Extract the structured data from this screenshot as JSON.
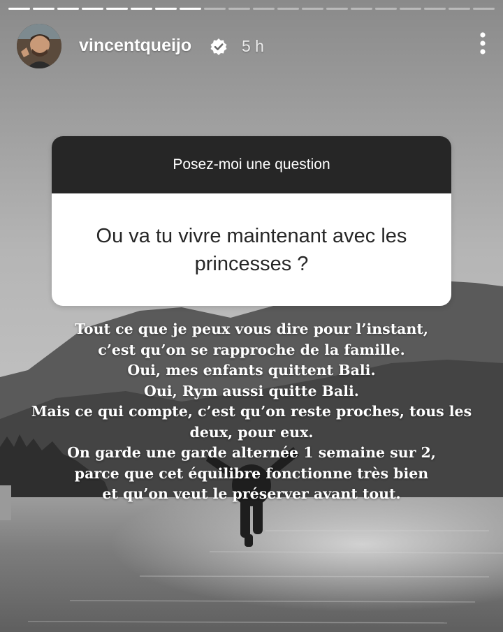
{
  "progress": {
    "total_segments": 20,
    "completed_segments": 8
  },
  "header": {
    "username": "vincentqueijo",
    "verified": true,
    "time": "5 h",
    "more_icon": "more-vertical-icon"
  },
  "question_sticker": {
    "title": "Posez-moi une question",
    "question": "Ou va tu vivre maintenant avec les princesses ?"
  },
  "caption": {
    "lines": [
      "Tout ce que je peux vous dire pour l’instant,",
      "c’est qu’on se rapproche de la famille.",
      "Oui, mes enfants quittent Bali.",
      "Oui, Rym aussi quitte Bali.",
      "Mais ce qui compte, c’est qu’on reste proches, tous les",
      "deux, pour eux.",
      "On garde une garde alternée 1 semaine sur 2,",
      "parce que cet équilibre fonctionne très bien",
      "et qu’on veut le préserver avant tout."
    ]
  },
  "colors": {
    "sticker_header": "#262626",
    "sticker_body": "#ffffff",
    "verified_badge": "#ffffff"
  }
}
